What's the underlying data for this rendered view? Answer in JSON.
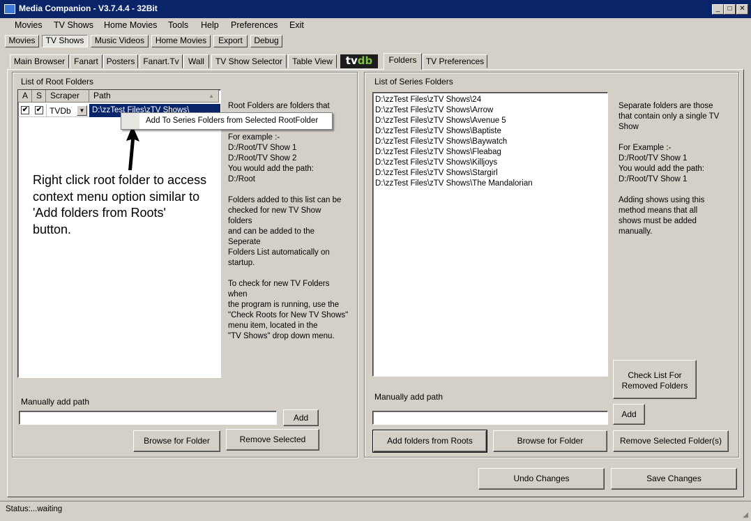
{
  "window": {
    "title": "Media Companion - V3.7.4.4 - 32Bit",
    "minimize": "_",
    "maximize": "□",
    "close": "✕"
  },
  "menu": [
    "Movies",
    "TV Shows",
    "Home Movies",
    "Tools",
    "Help",
    "Preferences",
    "Exit"
  ],
  "top_buttons": [
    "Movies",
    "TV Shows",
    "Music Videos",
    "Home Movies",
    "Export",
    "Debug"
  ],
  "tabs": [
    "Main Browser",
    "Fanart",
    "Posters",
    "Fanart.Tv",
    "Wall",
    "TV Show Selector",
    "Table View",
    "Folders",
    "TV Preferences"
  ],
  "tvdb_logo": {
    "part1": "tv",
    "part2": "db"
  },
  "root_panel": {
    "title": "List of Root Folders",
    "columns": [
      "A",
      "S",
      "Scraper",
      "Path"
    ],
    "rows": [
      {
        "a": "✔",
        "s": "✔",
        "scraper": "TVDb",
        "path": "D:\\zzTest Files\\zTV Shows\\"
      }
    ],
    "description": "Root Folders are folders that\n\n\nFor example :-\nD:/Root/TV Show 1\nD:/Root/TV Show 2\nYou would add the path:\nD:/Root\n\nFolders added to this list can be\nchecked for new TV Show\nfolders\nand can be added to the\nSeperate\nFolders List automatically on\nstartup.\n\nTo check for new TV Folders\nwhen\nthe program is running, use the\n\"Check Roots for New TV Shows\"\nmenu item, located in the\n\"TV Shows\" drop down menu.",
    "manual_label": "Manually add path",
    "manual_value": "",
    "add_button": "Add",
    "browse_button": "Browse for Folder",
    "remove_button": "Remove Selected"
  },
  "context_menu": {
    "item": "Add To Series Folders from Selected RootFolder"
  },
  "annotation": "Right click root folder to access\ncontext menu option similar to\n'Add folders from Roots'\nbutton.",
  "series_panel": {
    "title": "List of Series Folders",
    "items": [
      "D:\\zzTest Files\\zTV Shows\\24",
      "D:\\zzTest Files\\zTV Shows\\Arrow",
      "D:\\zzTest Files\\zTV Shows\\Avenue 5",
      "D:\\zzTest Files\\zTV Shows\\Baptiste",
      "D:\\zzTest Files\\zTV Shows\\Baywatch",
      "D:\\zzTest Files\\zTV Shows\\Fleabag",
      "D:\\zzTest Files\\zTV Shows\\Killjoys",
      "D:\\zzTest Files\\zTV Shows\\Stargirl",
      "D:\\zzTest Files\\zTV Shows\\The Mandalorian"
    ],
    "description": "Separate folders are those\nthat contain only a single TV\nShow\n\nFor Example :-\nD:/Root/TV Show 1\nYou would add the path:\nD:/Root/TV Show 1\n\nAdding shows using this\nmethod means that all\nshows must be added\nmanually.",
    "check_button": "Check List For\nRemoved Folders",
    "manual_label": "Manually add path",
    "manual_value": "",
    "add_button": "Add",
    "add_roots_button": "Add folders from Roots",
    "browse_button": "Browse for Folder",
    "remove_button": "Remove Selected Folder(s)"
  },
  "undo_button": "Undo Changes",
  "save_button": "Save Changes",
  "status": "Status:...waiting"
}
